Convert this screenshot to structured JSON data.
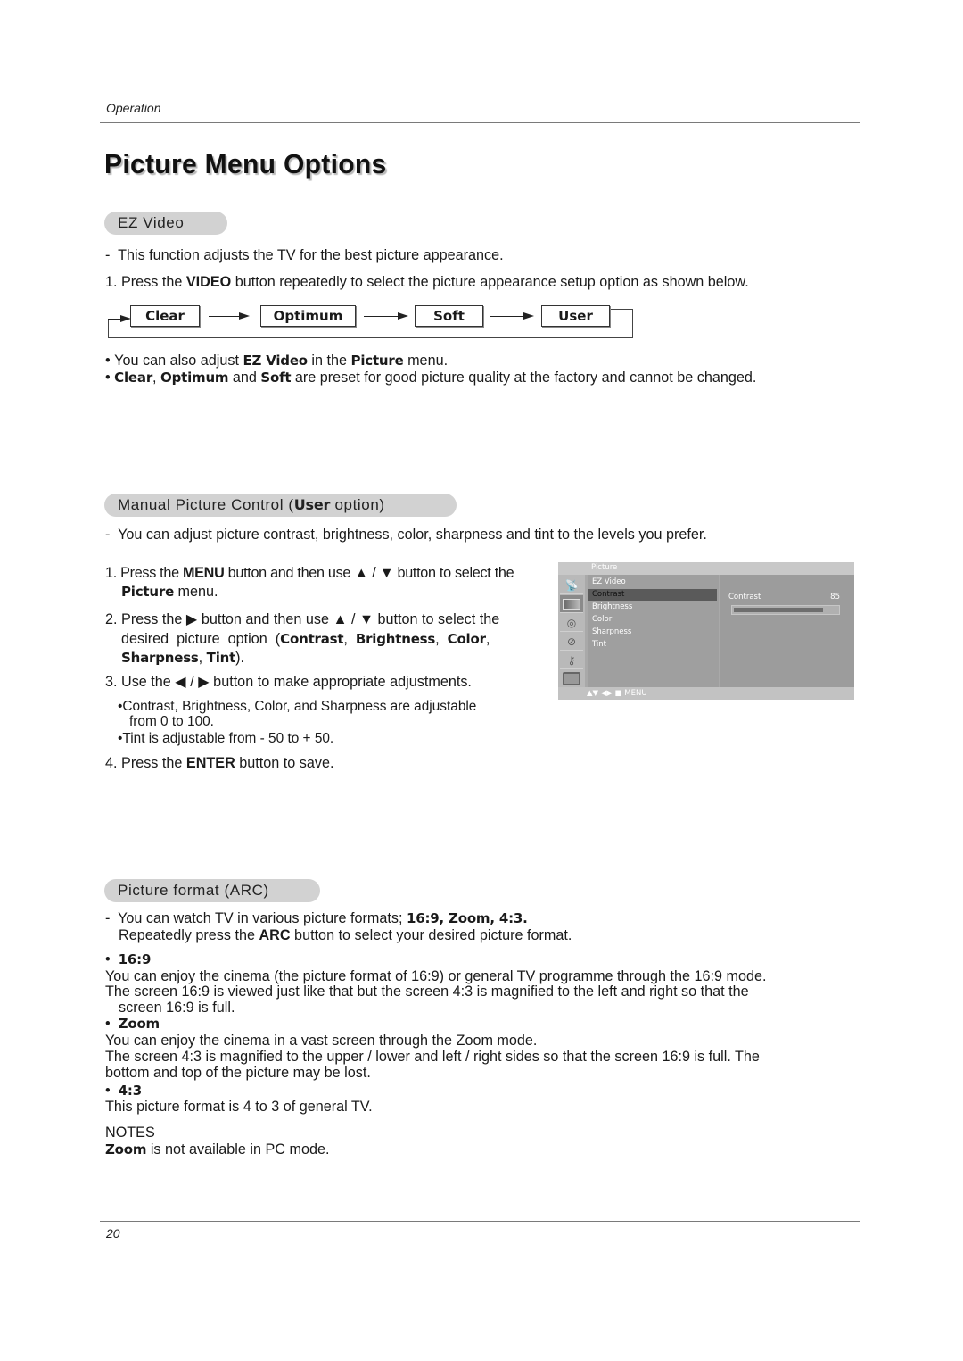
{
  "header": {
    "section": "Operation"
  },
  "page_title": "Picture Menu Options",
  "ez_video": {
    "heading": "EZ Video",
    "intro": "This function adjusts the TV for the best picture appearance.",
    "step1_pre": "1. Press the ",
    "step1_bold": "VIDEO",
    "step1_post": " button repeatedly to select the picture appearance setup option as shown below.",
    "flow": [
      "Clear",
      "Optimum",
      "Soft",
      "User"
    ],
    "bullets": [
      {
        "pre": "You can also adjust ",
        "b1": "EZ Video",
        "mid": " in the ",
        "b2": "Picture",
        "post": " menu."
      },
      {
        "b1": "Clear",
        "sep1": ", ",
        "b2": "Optimum",
        "sep2": " and ",
        "b3": "Soft",
        "post": " are preset for good picture quality at the factory and cannot be changed."
      }
    ]
  },
  "manual": {
    "heading_pre": "Manual Picture Control (",
    "heading_bold": "User",
    "heading_post": " option)",
    "intro": "You can adjust picture contrast, brightness, color, sharpness and tint to the levels you prefer.",
    "step1": {
      "num": "1.",
      "pre": "Press the ",
      "b1": "MENU",
      "mid": " button and then use ▲ / ▼ button to select the",
      "b2": "Picture",
      "post": " menu."
    },
    "step2": {
      "num": "2.",
      "pre": "Press the ▶  button and then use ▲ / ▼ button to select the",
      "line2_pre": "desired  picture  option  (",
      "b1": "Contrast",
      "s1": ",  ",
      "b2": "Brightness",
      "s2": ",  ",
      "b3": "Color",
      "s3": ",",
      "b4": "Sharpness",
      "s4": ", ",
      "b5": "Tint",
      "post": ")."
    },
    "step3": {
      "num": "3.",
      "text": "Use the ◀ / ▶ button to make appropriate adjustments."
    },
    "sub_bullets": [
      "Contrast, Brightness, Color, and Sharpness are adjustable",
      "from 0 to 100.",
      "Tint is adjustable from - 50 to + 50."
    ],
    "step4": {
      "num": "4.",
      "pre": "Press the ",
      "b1": "ENTER",
      "post": " button to save."
    }
  },
  "osd": {
    "menu_title": "Picture",
    "icons": [
      "satellite-dish-icon",
      "picture-icon",
      "speaker-icon",
      "clock-icon",
      "key-icon",
      "pc-monitor-icon"
    ],
    "items": [
      "EZ Video",
      "Contrast",
      "Brightness",
      "Color",
      "Sharpness",
      "Tint"
    ],
    "selected_item": "Contrast",
    "param_label": "Contrast",
    "param_value": "85",
    "param_fraction": 0.85,
    "nav_hint": "▲▼  ◀▶  ■  MENU"
  },
  "arc": {
    "heading": "Picture format (ARC)",
    "intro_pre": "You can watch TV in various picture formats; ",
    "intro_bold": "16:9, Zoom, 4:3.",
    "intro2_pre": "Repeatedly press the ",
    "intro2_bold": "ARC",
    "intro2_post": " button to select your desired picture format.",
    "formats": [
      {
        "name": "16:9",
        "lines": [
          "You can enjoy the cinema (the picture format of 16:9) or general TV programme through the 16:9 mode.",
          "The screen 16:9 is viewed just like that but the screen 4:3 is magnified to the left and right so that the",
          "screen 16:9 is full."
        ]
      },
      {
        "name": "Zoom",
        "lines": [
          "You can enjoy the cinema in a vast screen through the Zoom mode.",
          "The screen 4:3 is magnified to the upper / lower and left / right sides so that the screen 16:9 is full. The",
          "bottom and top of the picture may be lost."
        ]
      },
      {
        "name": "4:3",
        "lines": [
          "This picture format is 4 to 3 of general TV."
        ]
      }
    ],
    "notes_label": "NOTES",
    "note_bold": "Zoom",
    "note_post": " is not available in PC mode."
  },
  "footer": {
    "page_number": "20"
  }
}
